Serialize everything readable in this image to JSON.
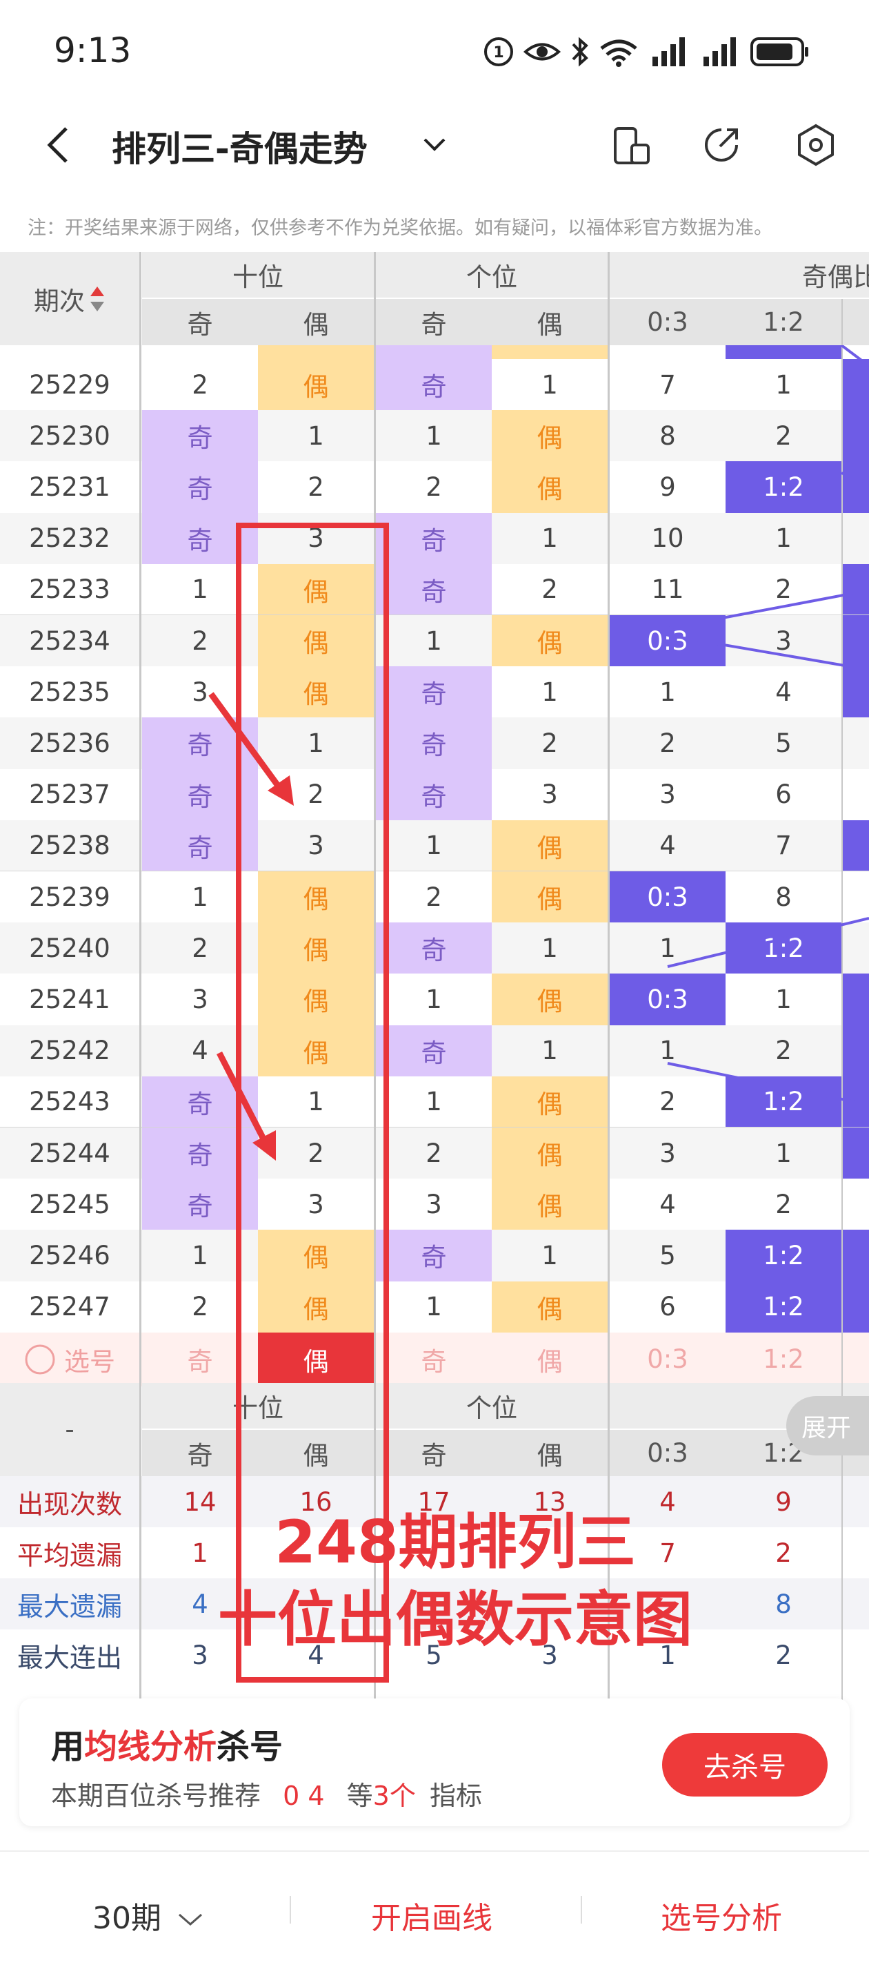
{
  "status_bar": {
    "time": "9:13"
  },
  "header": {
    "title": "排列三-奇偶走势"
  },
  "notice": "注：开奖结果来源于网络，仅供参考不作为兑奖依据。如有疑问，以福体彩官方数据为准。",
  "columns": {
    "period": "期次",
    "tens": "十位",
    "ones": "个位",
    "ratio": "奇偶比",
    "odd": "奇",
    "even": "偶",
    "r03": "0:3",
    "r12": "1:2"
  },
  "rows": [
    {
      "p": "25229",
      "to": "2",
      "te": "偶",
      "oo": "奇",
      "oe": "1",
      "r03": "7",
      "r12": "1"
    },
    {
      "p": "25230",
      "to": "奇",
      "te": "1",
      "oo": "1",
      "oe": "偶",
      "r03": "8",
      "r12": "2"
    },
    {
      "p": "25231",
      "to": "奇",
      "te": "2",
      "oo": "2",
      "oe": "偶",
      "r03": "9",
      "r12": "1:2"
    },
    {
      "p": "25232",
      "to": "奇",
      "te": "3",
      "oo": "奇",
      "oe": "1",
      "r03": "10",
      "r12": "1"
    },
    {
      "p": "25233",
      "to": "1",
      "te": "偶",
      "oo": "奇",
      "oe": "2",
      "r03": "11",
      "r12": "2"
    },
    {
      "p": "25234",
      "to": "2",
      "te": "偶",
      "oo": "1",
      "oe": "偶",
      "r03": "0:3",
      "r12": "3"
    },
    {
      "p": "25235",
      "to": "3",
      "te": "偶",
      "oo": "奇",
      "oe": "1",
      "r03": "1",
      "r12": "4"
    },
    {
      "p": "25236",
      "to": "奇",
      "te": "1",
      "oo": "奇",
      "oe": "2",
      "r03": "2",
      "r12": "5"
    },
    {
      "p": "25237",
      "to": "奇",
      "te": "2",
      "oo": "奇",
      "oe": "3",
      "r03": "3",
      "r12": "6"
    },
    {
      "p": "25238",
      "to": "奇",
      "te": "3",
      "oo": "1",
      "oe": "偶",
      "r03": "4",
      "r12": "7"
    },
    {
      "p": "25239",
      "to": "1",
      "te": "偶",
      "oo": "2",
      "oe": "偶",
      "r03": "0:3",
      "r12": "8"
    },
    {
      "p": "25240",
      "to": "2",
      "te": "偶",
      "oo": "奇",
      "oe": "1",
      "r03": "1",
      "r12": "1:2"
    },
    {
      "p": "25241",
      "to": "3",
      "te": "偶",
      "oo": "1",
      "oe": "偶",
      "r03": "0:3",
      "r12": "1"
    },
    {
      "p": "25242",
      "to": "4",
      "te": "偶",
      "oo": "奇",
      "oe": "1",
      "r03": "1",
      "r12": "2"
    },
    {
      "p": "25243",
      "to": "奇",
      "te": "1",
      "oo": "1",
      "oe": "偶",
      "r03": "2",
      "r12": "1:2"
    },
    {
      "p": "25244",
      "to": "奇",
      "te": "2",
      "oo": "2",
      "oe": "偶",
      "r03": "3",
      "r12": "1"
    },
    {
      "p": "25245",
      "to": "奇",
      "te": "3",
      "oo": "3",
      "oe": "偶",
      "r03": "4",
      "r12": "2"
    },
    {
      "p": "25246",
      "to": "1",
      "te": "偶",
      "oo": "奇",
      "oe": "1",
      "r03": "5",
      "r12": "1:2"
    },
    {
      "p": "25247",
      "to": "2",
      "te": "偶",
      "oo": "1",
      "oe": "偶",
      "r03": "6",
      "r12": "1:2"
    }
  ],
  "select_row": {
    "label": "选号",
    "to": "奇",
    "te": "偶",
    "oo": "奇",
    "oe": "偶",
    "r03": "0:3",
    "r12": "1:2"
  },
  "footer_head": {
    "dash": "-"
  },
  "stats": [
    {
      "label": "出现次数",
      "to": "14",
      "te": "16",
      "oo": "17",
      "oe": "13",
      "r03": "4",
      "r12": "9",
      "color": "#c0282d"
    },
    {
      "label": "平均遗漏",
      "to": "1",
      "te": "",
      "oo": "",
      "oe": "",
      "r03": "7",
      "r12": "2",
      "color": "#c0282d"
    },
    {
      "label": "最大遗漏",
      "to": "4",
      "te": "",
      "oo": "",
      "oe": "",
      "r03": "",
      "r12": "8",
      "color": "#3a6fc4"
    },
    {
      "label": "最大连出",
      "to": "3",
      "te": "4",
      "oo": "5",
      "oe": "3",
      "r03": "1",
      "r12": "2",
      "color": "#3a4a6a"
    }
  ],
  "annotation": {
    "line1": "248期排列三",
    "line2": "十位出偶数示意图"
  },
  "expand_label": "展开",
  "kill_card": {
    "prefix": "用",
    "highlight": "均线分析",
    "suffix": "杀号",
    "desc_prefix": "本期百位杀号推荐",
    "desc_nums": "0 4",
    "desc_mid": "等",
    "desc_count": "3个",
    "desc_suffix": "指标",
    "button": "去杀号"
  },
  "bottom_bar": {
    "periods": "30期",
    "draw_line": "开启画线",
    "analysis": "选号分析"
  },
  "colors": {
    "odd_bg": "#dcc6fb",
    "even_bg": "#ffe09e",
    "blue": "#6e5ce6",
    "red": "#ee3a3a",
    "even_text": "#f08a1c",
    "odd_text": "#7b5cc4"
  }
}
